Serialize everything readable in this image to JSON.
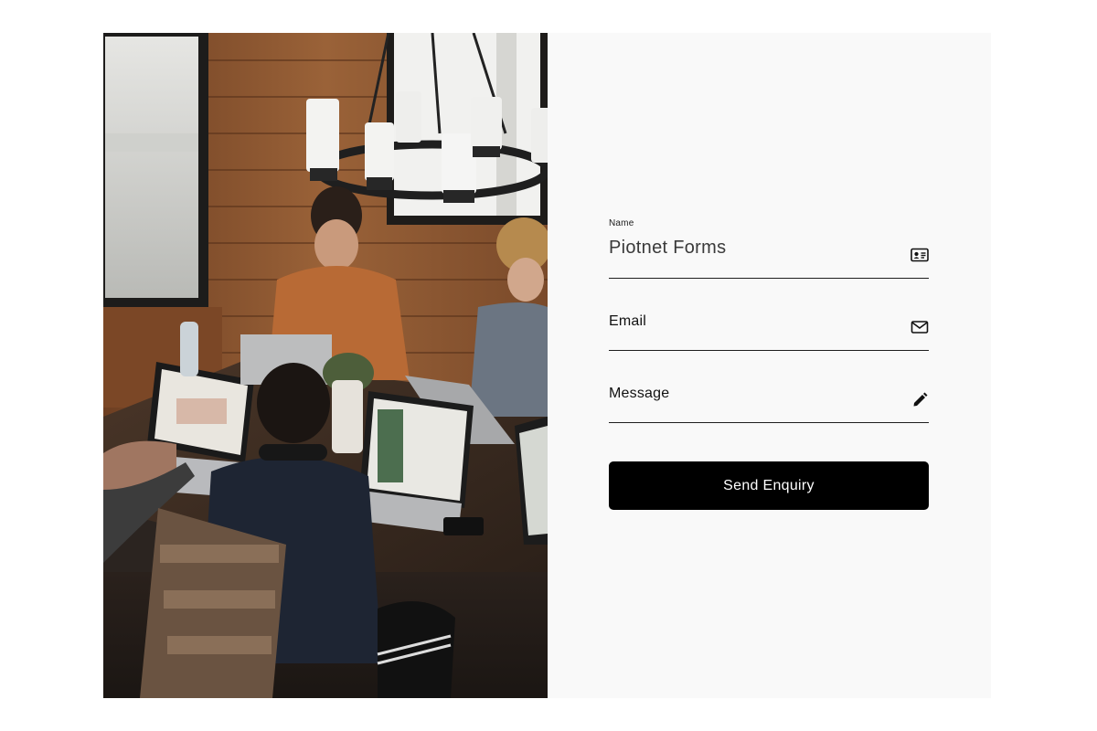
{
  "form": {
    "name": {
      "label": "Name",
      "value": "Piotnet Forms",
      "icon": "id-card-icon"
    },
    "email": {
      "placeholder": "Email",
      "icon": "envelope-icon"
    },
    "message": {
      "placeholder": "Message",
      "icon": "pencil-icon"
    },
    "submit_label": "Send Enquiry"
  },
  "colors": {
    "panel_background": "#f9f9f9",
    "button_background": "#000000",
    "button_text": "#ffffff",
    "underline": "#1e1e1e"
  }
}
